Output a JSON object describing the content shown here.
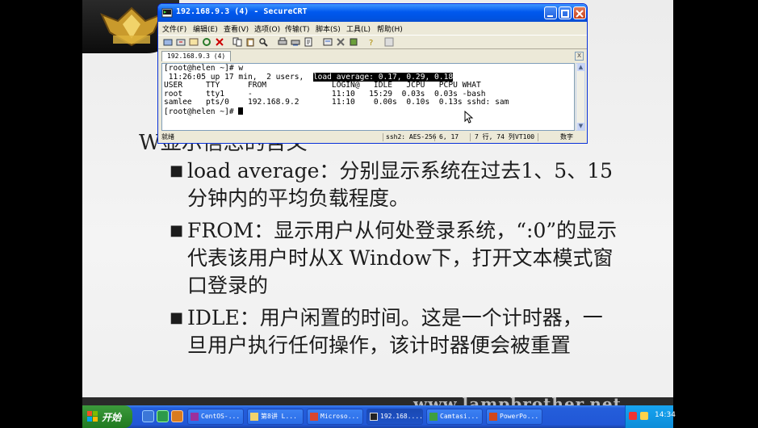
{
  "window": {
    "title": "192.168.9.3 (4) - SecureCRT",
    "menu": [
      "文件(F)",
      "编辑(E)",
      "查看(V)",
      "选项(O)",
      "传输(T)",
      "脚本(S)",
      "工具(L)",
      "帮助(H)"
    ],
    "tab_label": "192.168.9.3 (4)",
    "tab_close": "x"
  },
  "terminal": {
    "line1": "[root@helen ~]# w",
    "line2_pre": " 11:26:05 up 17 min,  2 users,  ",
    "line2_hl": "load average: 0.17, 0.29, 0.18",
    "line3": "USER     TTY      FROM              LOGIN@   IDLE   JCPU   PCPU WHAT",
    "line4": "root     tty1     -                 11:10   15:29  0.03s  0.03s -bash",
    "line5": "samlee   pts/0    192.168.9.2       11:10    0.00s  0.10s  0.13s sshd: sam",
    "line6": "[root@helen ~]# "
  },
  "status": {
    "ready": "就绪",
    "ssh": "ssh2: AES-256",
    "cursor_pos": "6,  17",
    "rows_cols": "7 行, 74 列",
    "term_type": "VT100",
    "num": "数字"
  },
  "slide": {
    "title_fragment": "W显示信息的含义",
    "bullets": [
      "load average：分别显示系统在过去1、5、15分钟内的平均负载程度。",
      "FROM：显示用户从何处登录系统，“:0”的显示代表该用户时从X Window下，打开文本模式窗口登录的",
      "IDLE：用户闲置的时间。这是一个计时器，一旦用户执行任何操作，该计时器便会被重置"
    ],
    "watermark": "www.lampbrother.net"
  },
  "taskbar": {
    "start": "开始",
    "tasks": [
      "CentOS-...",
      "第8讲 L...",
      "Microso...",
      "192.168....",
      "Camtasi...",
      "PowerPo..."
    ],
    "clock": "14:34"
  },
  "colors": {
    "titlebar": "#0058ee",
    "taskbar": "#245edb",
    "start": "#2d8a2d",
    "highlight_bg": "#000000"
  }
}
